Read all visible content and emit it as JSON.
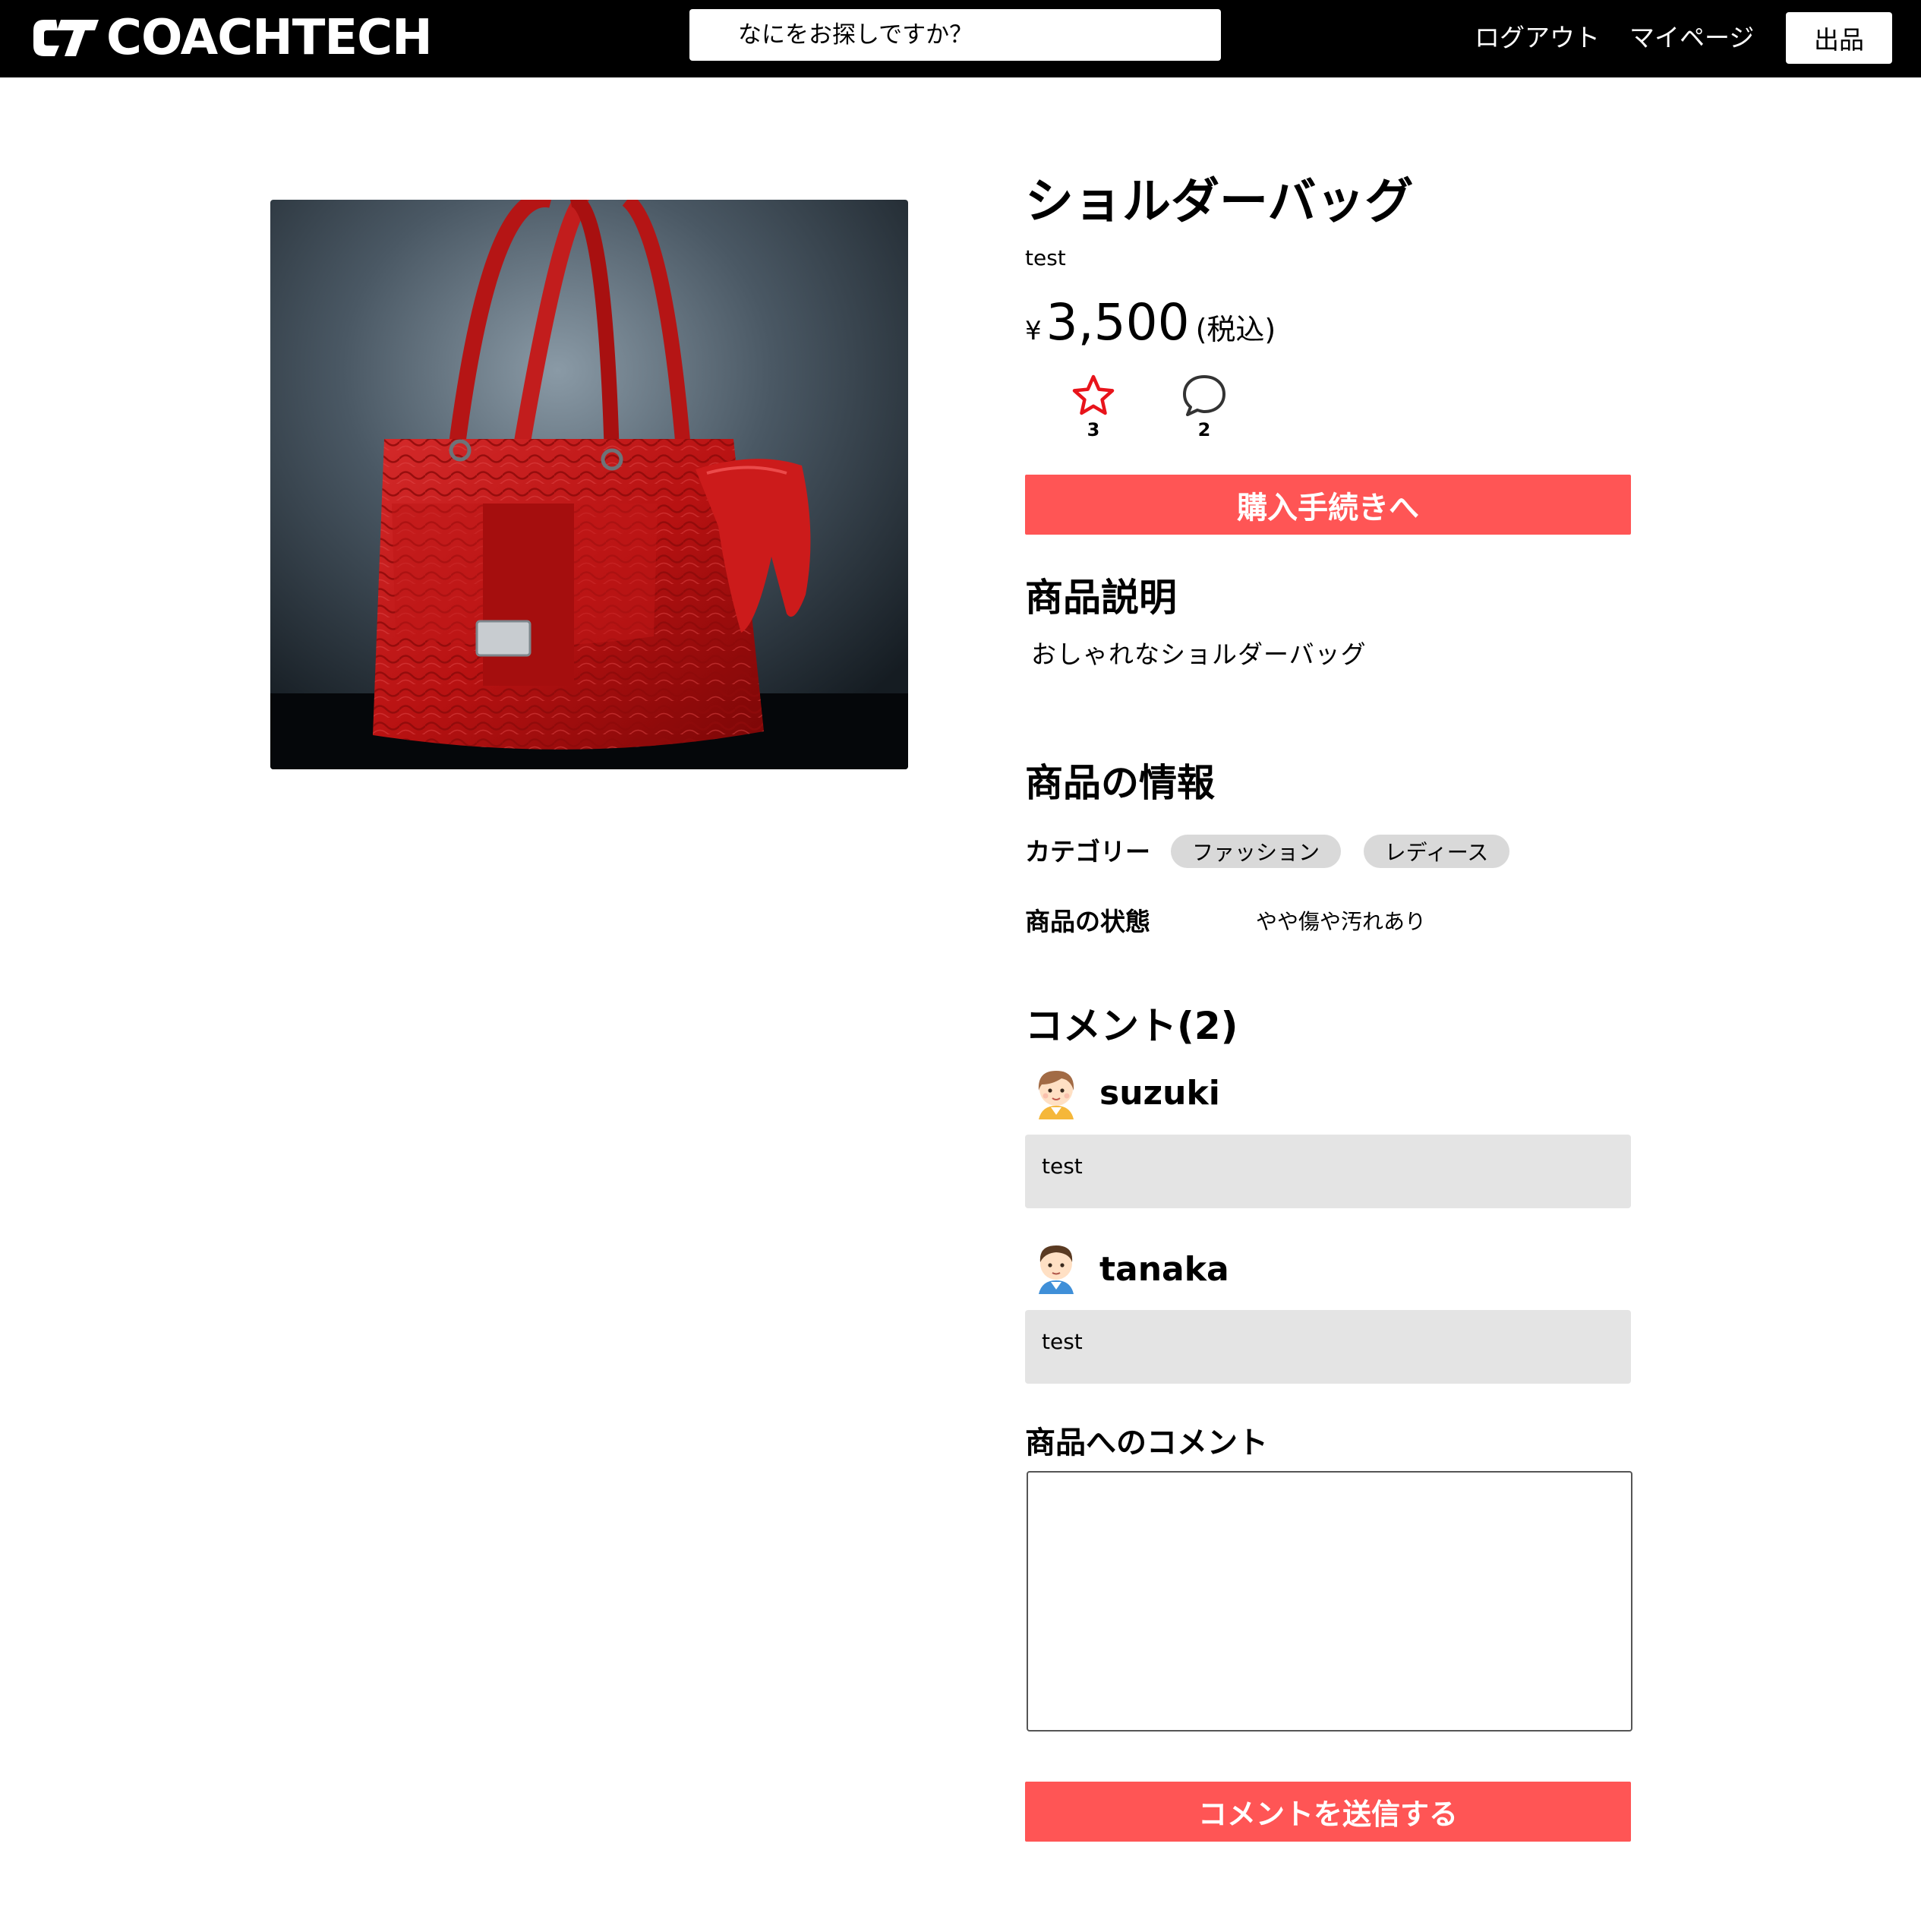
{
  "header": {
    "logo_text": "COACHTECH",
    "search_placeholder": "なにをお探しですか？",
    "logout_label": "ログアウト",
    "mypage_label": "マイページ",
    "sell_label": "出品"
  },
  "product": {
    "title": "ショルダーバッグ",
    "brand": "test",
    "price_symbol": "¥",
    "price": "3,500",
    "tax_label": "(税込)",
    "like_count": "3",
    "comment_count": "2",
    "buy_label": "購入手続きへ",
    "description_heading": "商品説明",
    "description": "おしゃれなショルダーバッグ",
    "info_heading": "商品の情報",
    "category_label": "カテゴリー",
    "categories": [
      "ファッション",
      "レディース"
    ],
    "condition_label": "商品の状態",
    "condition": "やや傷や汚れあり"
  },
  "comments": {
    "heading": "コメント(2)",
    "items": [
      {
        "user": "suzuki",
        "text": "test"
      },
      {
        "user": "tanaka",
        "text": "test"
      }
    ],
    "form_label": "商品へのコメント",
    "textarea_value": "",
    "submit_label": "コメントを送信する"
  },
  "colors": {
    "accent": "#ff5555",
    "header_bg": "#000000",
    "chip_bg": "#d9d9d9",
    "comment_bg": "#e4e4e4",
    "like_icon": "#e8141b"
  },
  "icons": {
    "like": "star-icon",
    "comment": "speech-bubble-icon"
  }
}
